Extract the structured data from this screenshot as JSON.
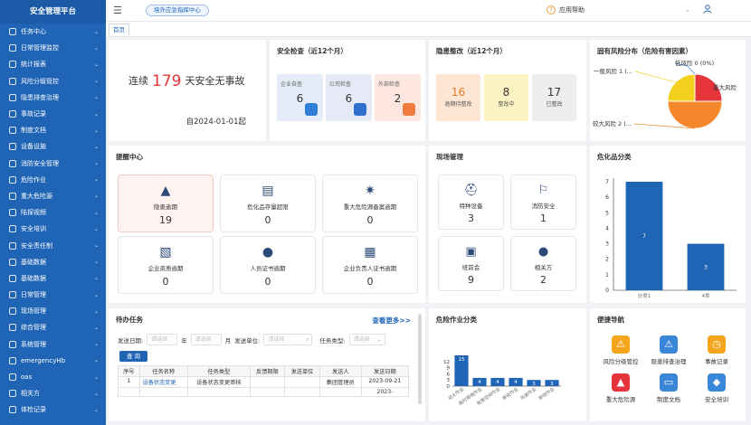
{
  "sidebar": {
    "title": "安全管理平台",
    "items": [
      {
        "label": "任务中心"
      },
      {
        "label": "日常管理监控"
      },
      {
        "label": "统计报表"
      },
      {
        "label": "风险分级管控"
      },
      {
        "label": "隐患排查治理"
      },
      {
        "label": "事故记录"
      },
      {
        "label": "制度文档"
      },
      {
        "label": "设备设施"
      },
      {
        "label": "消防安全管理"
      },
      {
        "label": "危险作业"
      },
      {
        "label": "重大危险源"
      },
      {
        "label": "陆探视频"
      },
      {
        "label": "安全培训"
      },
      {
        "label": "安全责任制"
      },
      {
        "label": "基础数据"
      },
      {
        "label": "基础数据"
      },
      {
        "label": "日常管理"
      },
      {
        "label": "现场管理"
      },
      {
        "label": "综合管理"
      },
      {
        "label": "系统管理"
      },
      {
        "label": "emergencyHb"
      },
      {
        "label": "oas"
      },
      {
        "label": "相关方"
      },
      {
        "label": "体检记录"
      }
    ]
  },
  "topbar": {
    "quick_link": "境外应急指挥中心",
    "help": "应用帮助"
  },
  "tabs": [
    {
      "label": "首页"
    }
  ],
  "safety": {
    "prefix": "连续",
    "days": "179",
    "suffix": "天安全无事故",
    "since": "自2024-01-01起"
  },
  "inspection": {
    "title": "安全检查（近12个月）",
    "items": [
      {
        "label": "企业自查",
        "value": "6",
        "bg": "#e3ecf8",
        "badge": "#2f7ed8"
      },
      {
        "label": "公司检查",
        "value": "6",
        "bg": "#e6eaf7",
        "badge": "#2f6fd0"
      },
      {
        "label": "外部检查",
        "value": "2",
        "bg": "#fde6df",
        "badge": "#f07b3f"
      }
    ]
  },
  "hazard": {
    "title": "隐患整改（近12个月）",
    "items": [
      {
        "label": "逾期待整改",
        "value": "16",
        "bg": "#fde6d4",
        "color": "#e57a1f"
      },
      {
        "label": "整改中",
        "value": "8",
        "bg": "#fcf3c2",
        "color": "#333333"
      },
      {
        "label": "已整改",
        "value": "17",
        "bg": "#eeeeee",
        "color": "#333333"
      }
    ]
  },
  "risk_pie": {
    "title": "固有风险分布（危险有害因素）",
    "chart_data": {
      "type": "pie",
      "slices": [
        {
          "label": "重大风险",
          "value": 1,
          "color": "#e5343a"
        },
        {
          "label": "较大风险",
          "value": 2,
          "display": "较大风险 2 (...",
          "color": "#f4862b"
        },
        {
          "label": "一般风险",
          "value": 1,
          "display": "一般风险 1 (...",
          "color": "#f5d11f"
        },
        {
          "label": "低风险",
          "value": 0,
          "display": "低风险 0 (0%)",
          "color": "#3a86d8"
        }
      ]
    }
  },
  "reminder": {
    "title": "提醒中心",
    "items": [
      {
        "label": "隐患逾期",
        "value": "19",
        "icon": "warning-icon",
        "bg": "#fff3f2",
        "border": "#f5c9c5"
      },
      {
        "label": "危化品存量超限",
        "value": "0",
        "icon": "database-icon",
        "bg": "#ffffff",
        "border": "#e3e6ea"
      },
      {
        "label": "重大危险源备案逾期",
        "value": "0",
        "icon": "explosion-icon",
        "bg": "#ffffff",
        "border": "#e3e6ea"
      },
      {
        "label": "企业资质逾期",
        "value": "0",
        "icon": "certificate-icon",
        "bg": "#ffffff",
        "border": "#e3e6ea"
      },
      {
        "label": "人员证书逾期",
        "value": "0",
        "icon": "person-icon",
        "bg": "#ffffff",
        "border": "#e3e6ea"
      },
      {
        "label": "企业负责人证书逾期",
        "value": "0",
        "icon": "document-icon",
        "bg": "#ffffff",
        "border": "#e3e6ea"
      }
    ]
  },
  "site": {
    "title": "现场管理",
    "items": [
      {
        "label": "特种设备",
        "value": "3",
        "icon": "helmet-icon"
      },
      {
        "label": "消防安全",
        "value": "1",
        "icon": "hydrant-icon"
      },
      {
        "label": "班前会",
        "value": "9",
        "icon": "presentation-icon"
      },
      {
        "label": "相关方",
        "value": "2",
        "icon": "worker-icon"
      }
    ]
  },
  "chem": {
    "title": "危化品分类",
    "chart_data": {
      "type": "bar",
      "categories": [
        "分类1",
        "4类"
      ],
      "values": [
        7,
        3
      ],
      "ylim": [
        0,
        7
      ],
      "yticks": [
        0,
        1,
        2,
        3,
        4,
        5,
        6,
        7
      ]
    }
  },
  "todo": {
    "title": "待办任务",
    "more": "查看更多>>",
    "filters": {
      "date_label": "发送日期:",
      "date_placeholder": "请选择",
      "year_unit": "年",
      "month_placeholder": "请选择",
      "month_unit": "月",
      "unit_label": "发送单位:",
      "unit_placeholder": "请选择",
      "type_label": "任务类型:",
      "type_placeholder": "请选择"
    },
    "query_button": "查 询",
    "columns": [
      "序号",
      "任务名称",
      "任务类型",
      "反馈期限",
      "发送单位",
      "发送人",
      "发送日期"
    ],
    "rows": [
      {
        "no": "1",
        "name": "设备状态变更",
        "type": "设备状态变更审核",
        "deadline": "",
        "unit": "",
        "sender": "集团管理员",
        "date": "2023-09-21"
      },
      {
        "no": "",
        "name": "",
        "type": "",
        "deadline": "",
        "unit": "",
        "sender": "",
        "date": "2023-"
      }
    ]
  },
  "danger_work": {
    "title": "危险作业分类",
    "chart_data": {
      "type": "bar",
      "categories": [
        "动火作业",
        "临时用电作业",
        "有限空间作业",
        "高处作业",
        "吊装作业",
        "其他作业"
      ],
      "values": [
        15,
        4,
        4,
        4,
        3,
        3
      ],
      "yticks": [
        0,
        3,
        6,
        9,
        12
      ],
      "ylim": [
        0,
        15
      ]
    }
  },
  "quicknav": {
    "title": "便捷导航",
    "items": [
      {
        "label": "风险分级管控",
        "icon": "risk-icon",
        "color": "#f4a51c"
      },
      {
        "label": "隐患排查治理",
        "icon": "search-warning-icon",
        "color": "#3a86d8"
      },
      {
        "label": "事故记录",
        "icon": "clock-icon",
        "color": "#f4a51c"
      },
      {
        "label": "重大危险源",
        "icon": "warning-icon",
        "color": "#e5343a"
      },
      {
        "label": "制度文档",
        "icon": "folder-icon",
        "color": "#3a86d8"
      },
      {
        "label": "安全培训",
        "icon": "graduation-icon",
        "color": "#3a86d8"
      }
    ]
  }
}
